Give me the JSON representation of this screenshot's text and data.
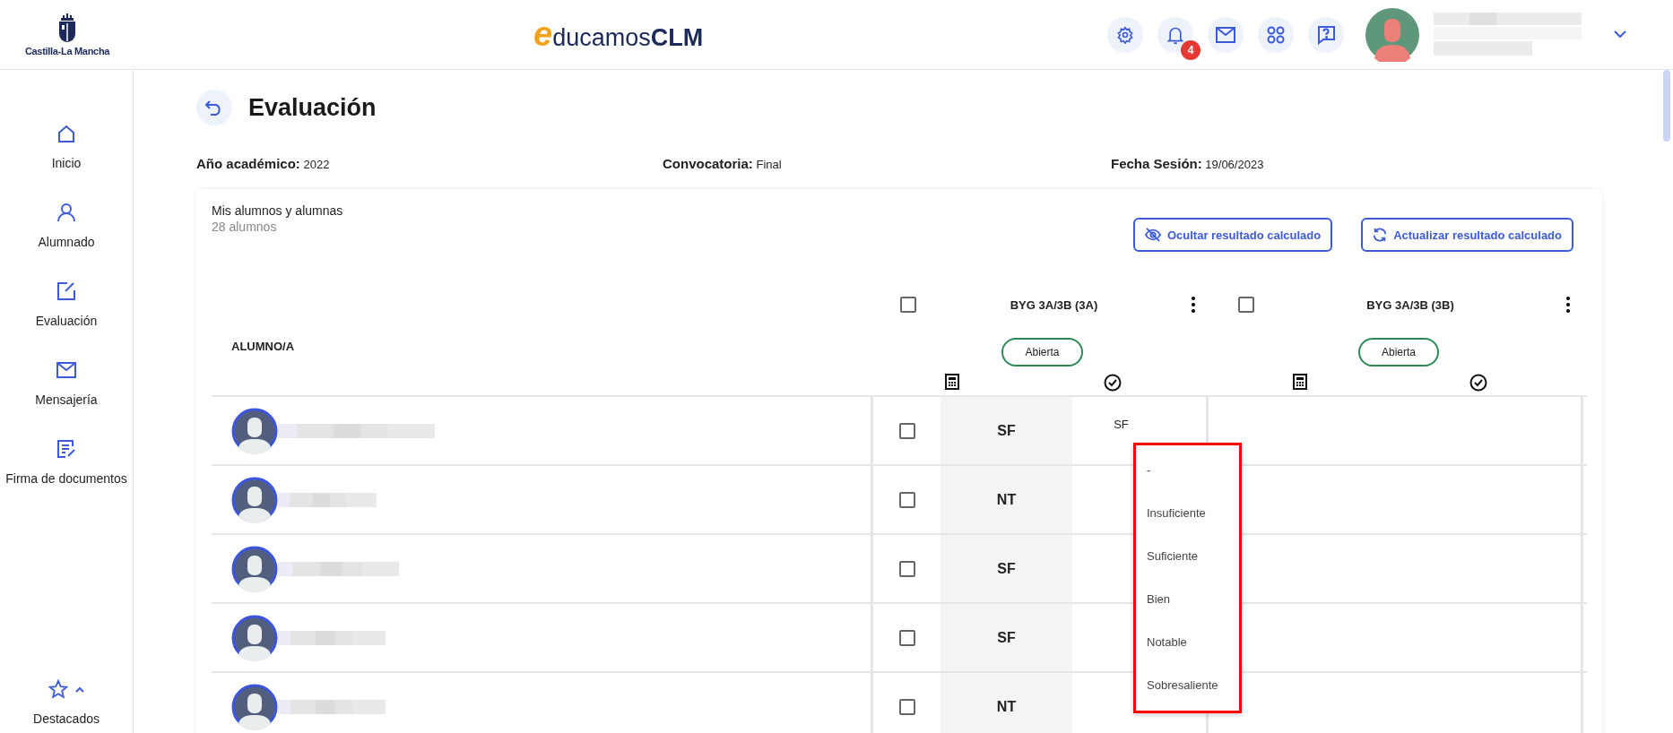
{
  "header": {
    "region_name": "Castilla-La Mancha",
    "brand": {
      "initial": "e",
      "middle": "ducamos",
      "strong": "CLM"
    },
    "notifications": "4"
  },
  "sidebar": {
    "items": [
      {
        "label": "Inicio"
      },
      {
        "label": "Alumnado"
      },
      {
        "label": "Evaluación"
      },
      {
        "label": "Mensajería"
      },
      {
        "label": "Firma de documentos"
      }
    ],
    "footer": {
      "label": "Destacados"
    }
  },
  "page": {
    "title": "Evaluación",
    "info": [
      {
        "label": "Año académico:",
        "value": "2022"
      },
      {
        "label": "Convocatoria:",
        "value": "Final"
      },
      {
        "label": "Fecha Sesión:",
        "value": "19/06/2023"
      }
    ]
  },
  "card": {
    "title": "Mis alumnos y alumnas",
    "subtitle": "28 alumnos",
    "buttons": [
      {
        "label": "Ocultar resultado calculado"
      },
      {
        "label": "Actualizar resultado calculado"
      }
    ],
    "name_header": "ALUMNO/A",
    "groups": [
      {
        "title": "BYG 3A/3B (3A)",
        "checked": false,
        "status": "Abierta"
      },
      {
        "title": "BYG 3A/3B (3B)",
        "checked": false,
        "status": "Abierta"
      }
    ],
    "rows": [
      {
        "checked": false,
        "calculated": "SF",
        "value": "SF"
      },
      {
        "checked": false,
        "calculated": "NT"
      },
      {
        "checked": false,
        "calculated": "SF"
      },
      {
        "checked": false,
        "calculated": "SF"
      },
      {
        "checked": false,
        "calculated": "NT"
      }
    ],
    "dropdown": {
      "options": [
        "-",
        "Insuficiente",
        "Suficiente",
        "Bien",
        "Notable",
        "Sobresaliente"
      ]
    }
  }
}
